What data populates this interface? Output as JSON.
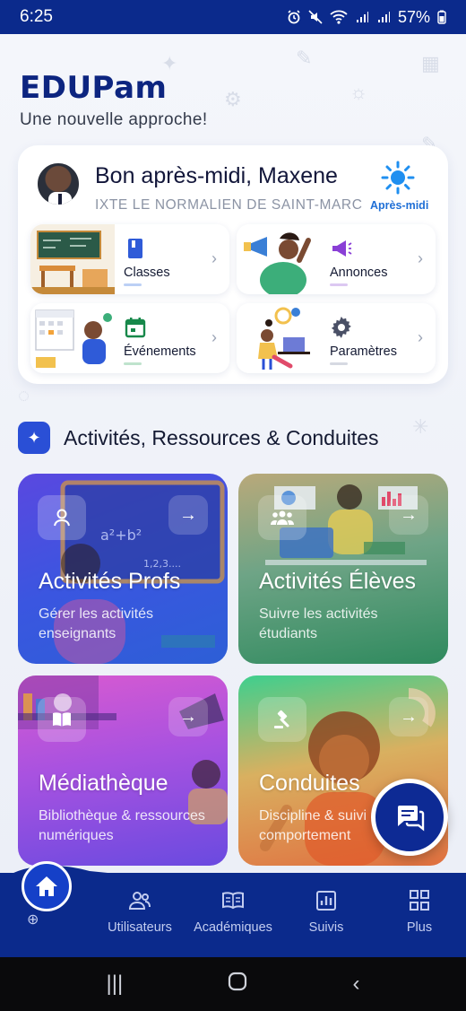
{
  "status_bar": {
    "time": "6:25",
    "battery": "57%"
  },
  "header": {
    "brand": "EDUPam",
    "tagline": "Une nouvelle approche!"
  },
  "welcome": {
    "greeting": "Bon après-midi, Maxene",
    "school": "IXTE LE NORMALIEN DE SAINT-MARC",
    "period": "Après-midi",
    "tiles": [
      {
        "label": "Classes",
        "icon": "book-icon",
        "color": "#2f5bd8"
      },
      {
        "label": "Annonces",
        "icon": "megaphone-icon",
        "color": "#8a3fd6"
      },
      {
        "label": "Événements",
        "icon": "calendar-icon",
        "color": "#17884a"
      },
      {
        "label": "Paramètres",
        "icon": "gear-icon",
        "color": "#4a5066"
      }
    ]
  },
  "section": {
    "title": "Activités, Ressources & Conduites"
  },
  "cards": [
    {
      "title": "Activités Profs",
      "subtitle": "Gérer les activités enseignants",
      "icon": "person-icon"
    },
    {
      "title": "Activités Élèves",
      "subtitle": "Suivre les activités étudiants",
      "icon": "group-icon"
    },
    {
      "title": "Médiathèque",
      "subtitle": "Bibliothèque & ressources numériques",
      "icon": "open-book-icon"
    },
    {
      "title": "Conduites",
      "subtitle": "Discipline & suivi comportement",
      "icon": "gavel-icon"
    }
  ],
  "bottom_nav": {
    "items": [
      {
        "label": "Utilisateurs",
        "icon": "users-icon"
      },
      {
        "label": "Académiques",
        "icon": "open-book-icon"
      },
      {
        "label": "Suivis",
        "icon": "chart-icon"
      },
      {
        "label": "Plus",
        "icon": "grid-icon"
      }
    ]
  },
  "colors": {
    "primary": "#0b2a8c",
    "accent": "#2a4fd6"
  }
}
